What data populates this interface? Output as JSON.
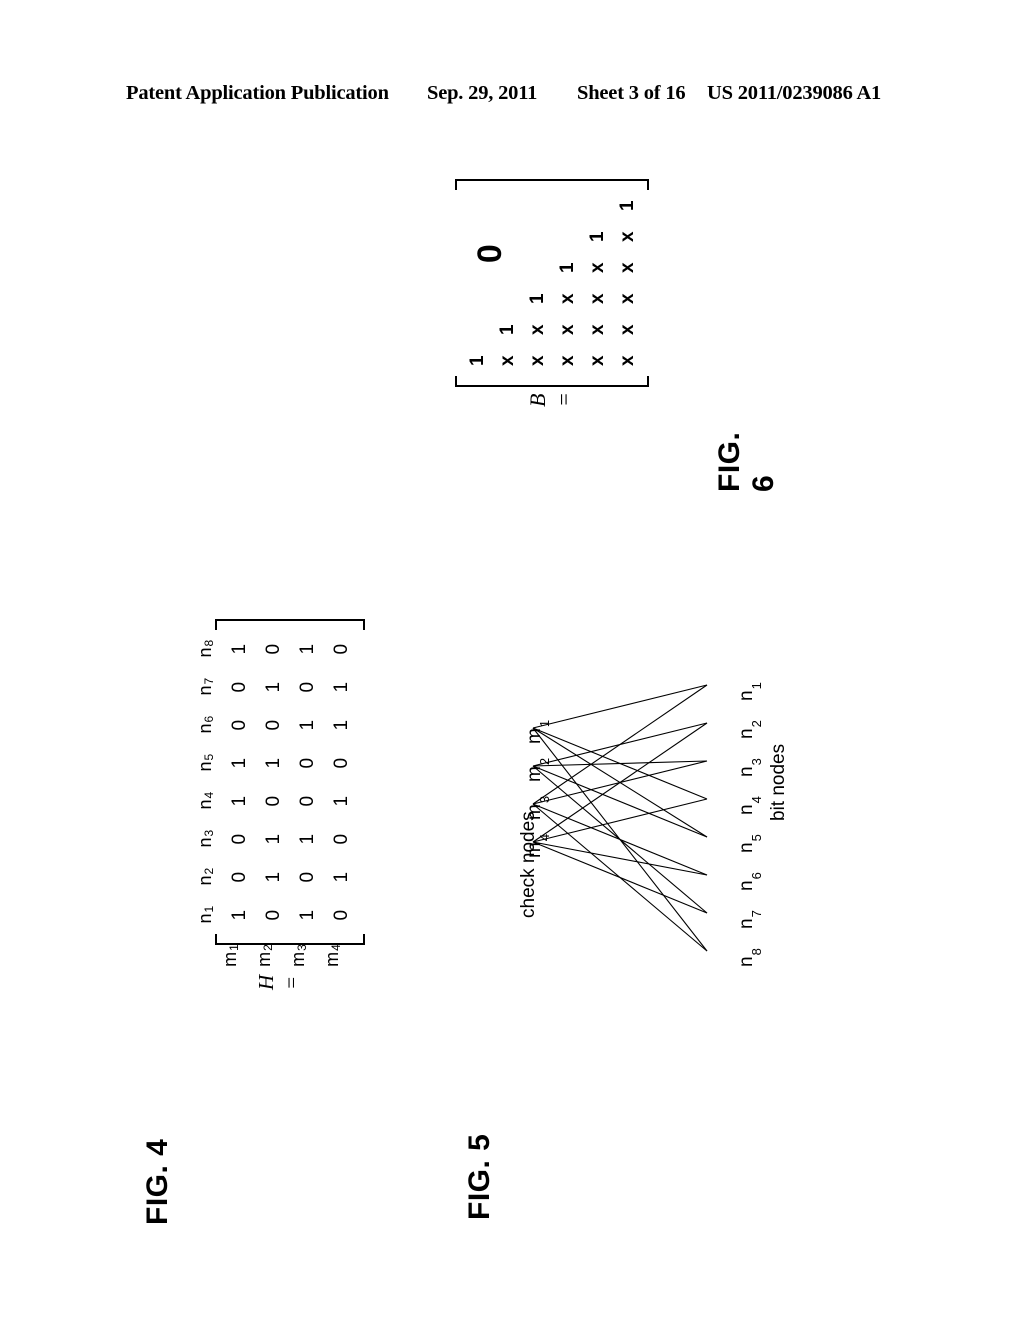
{
  "header": {
    "publication": "Patent Application Publication",
    "date": "Sep. 29, 2011",
    "sheet": "Sheet 3 of 16",
    "publication_number": "US 2011/0239086 A1"
  },
  "figures": {
    "fig4": {
      "caption": "FIG. 4",
      "matrix_label": "H =",
      "col_headers": [
        "n1",
        "n2",
        "n3",
        "n4",
        "n5",
        "n6",
        "n7",
        "n8"
      ],
      "col_header_base": [
        "n",
        "n",
        "n",
        "n",
        "n",
        "n",
        "n",
        "n"
      ],
      "col_header_sub": [
        "1",
        "2",
        "3",
        "4",
        "5",
        "6",
        "7",
        "8"
      ],
      "row_headers": [
        "m1",
        "m2",
        "m3",
        "m4"
      ],
      "row_header_base": [
        "m",
        "m",
        "m",
        "m"
      ],
      "row_header_sub": [
        "1",
        "2",
        "3",
        "4"
      ],
      "rows": [
        [
          "1",
          "0",
          "0",
          "1",
          "1",
          "0",
          "0",
          "1"
        ],
        [
          "0",
          "1",
          "1",
          "0",
          "1",
          "0",
          "1",
          "0"
        ],
        [
          "1",
          "0",
          "1",
          "0",
          "0",
          "1",
          "0",
          "1"
        ],
        [
          "0",
          "1",
          "0",
          "1",
          "0",
          "1",
          "1",
          "0"
        ]
      ]
    },
    "fig5": {
      "caption": "FIG. 5",
      "check_nodes_label": "check nodes",
      "bit_nodes_label": "bit nodes",
      "check_nodes": [
        "m1",
        "m2",
        "m3",
        "m4"
      ],
      "check_node_base": [
        "m",
        "m",
        "m",
        "m"
      ],
      "check_node_sub": [
        "1",
        "2",
        "3",
        "4"
      ],
      "bit_nodes": [
        "n1",
        "n2",
        "n3",
        "n4",
        "n5",
        "n6",
        "n7",
        "n8"
      ],
      "bit_node_base": [
        "n",
        "n",
        "n",
        "n",
        "n",
        "n",
        "n",
        "n"
      ],
      "bit_node_sub": [
        "1",
        "2",
        "3",
        "4",
        "5",
        "6",
        "7",
        "8"
      ],
      "edges": [
        [
          0,
          0
        ],
        [
          0,
          3
        ],
        [
          0,
          4
        ],
        [
          0,
          7
        ],
        [
          1,
          1
        ],
        [
          1,
          2
        ],
        [
          1,
          4
        ],
        [
          1,
          6
        ],
        [
          2,
          0
        ],
        [
          2,
          2
        ],
        [
          2,
          5
        ],
        [
          2,
          7
        ],
        [
          3,
          1
        ],
        [
          3,
          3
        ],
        [
          3,
          5
        ],
        [
          3,
          6
        ]
      ]
    },
    "fig6": {
      "caption": "FIG. 6",
      "matrix_label": "B =",
      "zero_label": "0",
      "rows": [
        [
          "1",
          "",
          "",
          "",
          "",
          ""
        ],
        [
          "x",
          "1",
          "",
          "",
          "",
          ""
        ],
        [
          "x",
          "x",
          "1",
          "",
          "",
          ""
        ],
        [
          "x",
          "x",
          "x",
          "1",
          "",
          ""
        ],
        [
          "x",
          "x",
          "x",
          "x",
          "1",
          ""
        ],
        [
          "x",
          "x",
          "x",
          "x",
          "x",
          "1"
        ]
      ]
    }
  },
  "colors": {
    "ink": "#000000",
    "paper": "#ffffff"
  }
}
